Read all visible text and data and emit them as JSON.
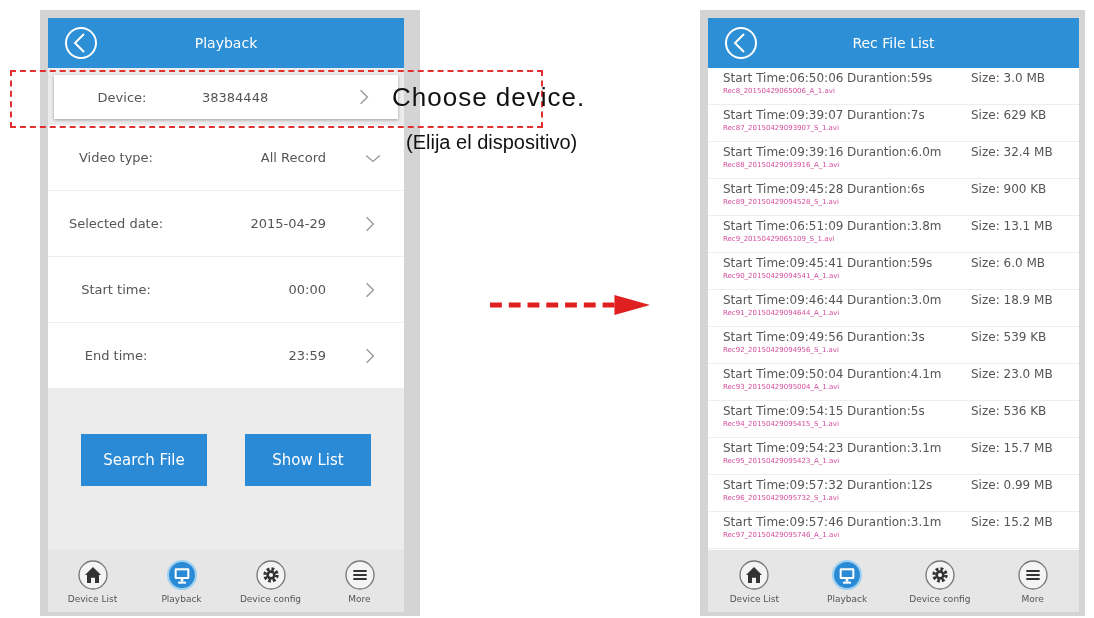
{
  "playback_screen": {
    "title": "Playback",
    "device": {
      "label": "Device:",
      "value": "38384448"
    },
    "fields": [
      {
        "label": "Video type:",
        "value": "All Record",
        "kind": "dropdown"
      },
      {
        "label": "Selected date:",
        "value": "2015-04-29",
        "kind": "link"
      },
      {
        "label": "Start time:",
        "value": "00:00",
        "kind": "link"
      },
      {
        "label": "End time:",
        "value": "23:59",
        "kind": "link"
      }
    ],
    "buttons": [
      "Search File",
      "Show List"
    ],
    "tab_bar": [
      {
        "label": "Device List",
        "selected": false
      },
      {
        "label": "Playback",
        "selected": true
      },
      {
        "label": "Device config",
        "selected": false
      },
      {
        "label": "More",
        "selected": false
      }
    ]
  },
  "annotation": {
    "title": "Choose device.",
    "subtitle": "(Elija el dispositivo)"
  },
  "rec_file_list_screen": {
    "title": "Rec File List",
    "files": [
      {
        "start_time": "Start Time:06:50:06",
        "duration": "Durantion:59s",
        "size": "Size: 3.0 MB",
        "filename": "Rec8_20150429065006_A_1.avi"
      },
      {
        "start_time": "Start Time:09:39:07",
        "duration": "Durantion:7s",
        "size": "Size: 629 KB",
        "filename": "Rec87_20150429093907_S_1.avi"
      },
      {
        "start_time": "Start Time:09:39:16",
        "duration": "Durantion:6.0m",
        "size": "Size: 32.4 MB",
        "filename": "Rec88_20150429093916_A_1.avi"
      },
      {
        "start_time": "Start Time:09:45:28",
        "duration": "Durantion:6s",
        "size": "Size: 900 KB",
        "filename": "Rec89_20150429094528_S_1.avi"
      },
      {
        "start_time": "Start Time:06:51:09",
        "duration": "Durantion:3.8m",
        "size": "Size: 13.1 MB",
        "filename": "Rec9_20150429065109_S_1.avi"
      },
      {
        "start_time": "Start Time:09:45:41",
        "duration": "Durantion:59s",
        "size": "Size: 6.0 MB",
        "filename": "Rec90_20150429094541_A_1.avi"
      },
      {
        "start_time": "Start Time:09:46:44",
        "duration": "Durantion:3.0m",
        "size": "Size: 18.9 MB",
        "filename": "Rec91_20150429094644_A_1.avi"
      },
      {
        "start_time": "Start Time:09:49:56",
        "duration": "Durantion:3s",
        "size": "Size: 539 KB",
        "filename": "Rec92_20150429094956_S_1.avi"
      },
      {
        "start_time": "Start Time:09:50:04",
        "duration": "Durantion:4.1m",
        "size": "Size: 23.0 MB",
        "filename": "Rec93_20150429095004_A_1.avi"
      },
      {
        "start_time": "Start Time:09:54:15",
        "duration": "Durantion:5s",
        "size": "Size: 536 KB",
        "filename": "Rec94_20150429095415_S_1.avi"
      },
      {
        "start_time": "Start Time:09:54:23",
        "duration": "Durantion:3.1m",
        "size": "Size: 15.7 MB",
        "filename": "Rec95_20150429095423_A_1.avi"
      },
      {
        "start_time": "Start Time:09:57:32",
        "duration": "Durantion:12s",
        "size": "Size: 0.99 MB",
        "filename": "Rec96_20150429095732_S_1.avi"
      },
      {
        "start_time": "Start Time:09:57:46",
        "duration": "Durantion:3.1m",
        "size": "Size: 15.2 MB",
        "filename": "Rec97_20150429095746_A_1.avi"
      }
    ],
    "tab_bar": [
      {
        "label": "Device List",
        "selected": false
      },
      {
        "label": "Playback",
        "selected": true
      },
      {
        "label": "Device config",
        "selected": false
      },
      {
        "label": "More",
        "selected": false
      }
    ]
  }
}
